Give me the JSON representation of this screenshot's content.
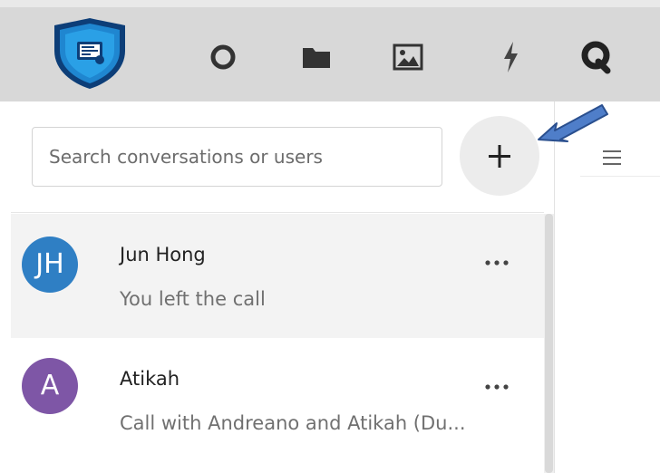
{
  "topnav": {
    "items": [
      {
        "name": "logo-shield-icon"
      },
      {
        "name": "status-circle-icon"
      },
      {
        "name": "folder-icon"
      },
      {
        "name": "image-icon"
      },
      {
        "name": "activity-bolt-icon"
      },
      {
        "name": "chat-q-icon"
      }
    ],
    "bar_color": "#d8d8d8"
  },
  "search": {
    "placeholder": "Search conversations or users"
  },
  "add_button": {
    "label": "+"
  },
  "conversations": [
    {
      "initials": "JH",
      "name": "Jun Hong",
      "preview": "You left the call",
      "avatar_color": "#2f7fc4",
      "more": "•••"
    },
    {
      "initials": "A",
      "name": "Atikah",
      "preview": "Call with Andreano and Atikah (Du...",
      "avatar_color": "#7e56a6",
      "more": "•••"
    }
  ],
  "annotation": {
    "arrow_color": "#4f7ec9"
  }
}
